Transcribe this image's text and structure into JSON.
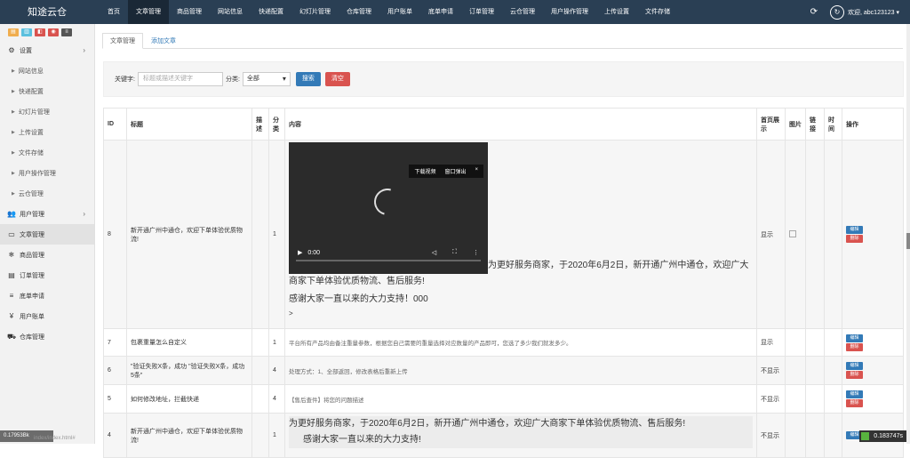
{
  "app": {
    "logo": "知途云仓"
  },
  "nav": {
    "items": [
      "首页",
      "文章管理",
      "商品管理",
      "网站信息",
      "快递配置",
      "幻灯片管理",
      "仓库管理",
      "用户账单",
      "底单申请",
      "订单管理",
      "云仓管理",
      "用户操作管理",
      "上传设置",
      "文件存储"
    ],
    "active_index": 1,
    "welcome": "欢迎, abc123123 ▾"
  },
  "sidebar": {
    "buttons": [
      "▤",
      "▥",
      "◧",
      "◉",
      "≡"
    ],
    "button_colors": [
      "#f0ad4e",
      "#5bc0de",
      "#d9534f",
      "#d9534f",
      "#555555"
    ],
    "items": [
      {
        "label": "设置",
        "icon": "gears-icon",
        "glyph": "⚙",
        "chev": "›",
        "sub": false
      },
      {
        "label": "网站信息",
        "sub": true
      },
      {
        "label": "快递配置",
        "sub": true
      },
      {
        "label": "幻灯片管理",
        "sub": true
      },
      {
        "label": "上传设置",
        "sub": true
      },
      {
        "label": "文件存储",
        "sub": true
      },
      {
        "label": "用户操作管理",
        "sub": true
      },
      {
        "label": "云仓管理",
        "sub": true
      },
      {
        "label": "用户管理",
        "icon": "users-icon",
        "glyph": "👥",
        "chev": "›",
        "sub": false
      },
      {
        "label": "文章管理",
        "icon": "list-alt-icon",
        "glyph": "▭",
        "sub": false,
        "active": true
      },
      {
        "label": "商品管理",
        "icon": "snowflake-icon",
        "glyph": "❄",
        "sub": false
      },
      {
        "label": "订单管理",
        "icon": "file-icon",
        "glyph": "▤",
        "sub": false
      },
      {
        "label": "底单申请",
        "icon": "bars-icon",
        "glyph": "≡",
        "sub": false
      },
      {
        "label": "用户账单",
        "icon": "yen-icon",
        "glyph": "¥",
        "sub": false
      },
      {
        "label": "仓库管理",
        "icon": "truck-icon",
        "glyph": "⛟",
        "sub": false
      }
    ]
  },
  "tabs": [
    "文章管理",
    "添加文章"
  ],
  "filter": {
    "keyword_label": "关键字:",
    "keyword_placeholder": "标题或描述关键字",
    "category_label": "分类:",
    "category_value": "全部",
    "search_label": "搜索",
    "clear_label": "清空"
  },
  "table": {
    "headers": [
      "ID",
      "标题",
      "描述",
      "分类",
      "内容",
      "首页展示",
      "图片",
      "链接",
      "时间",
      "操作"
    ],
    "edit_label": "编辑",
    "delete_label": "删除",
    "rows": [
      {
        "id": "8",
        "title": "新开通广州中通仓，欢迎下单体验优质物流!",
        "category": "1",
        "content_text": "为更好服务商家，于2020年6月2日，新开通广州中通仓，欢迎广大商家下单体验优质物流、售后服务!",
        "content_text2": "感谢大家一直以来的大力支持！000",
        "content_more": ">",
        "video_time": "0:00",
        "video_menu": [
          "下载视频",
          "窗口弹出",
          "×"
        ],
        "home_show": "显示"
      },
      {
        "id": "7",
        "title": "包裹重量怎么自定义",
        "category": "1",
        "content_text": "平台所有产品均由备注重量参数，根据您自己需要的重量选择对应数量的产品即可，您选了多少我们就发多少。",
        "home_show": "显示"
      },
      {
        "id": "6",
        "title": "\"验证失败X条，成功 \"验证失败X条，成功5条\"",
        "category": "4",
        "content_text": "处理方式：1、全部返回，修改表格后重新上传",
        "home_show": "不显示"
      },
      {
        "id": "5",
        "title": "如何修改地址，拦截快递",
        "category": "4",
        "content_text": "【售后查件】将您的问题描述",
        "home_show": "不显示"
      },
      {
        "id": "4",
        "title": "新开通广州中通仓，欢迎下单体验优质物流!",
        "category": "1",
        "content_text": "为更好服务商家，于2020年6月2日，新开通广州中通仓，欢迎广大商家下单体验优质物流、售后服务!",
        "content_text2": "感谢大家一直以来的大力支持!",
        "home_show": "不显示"
      }
    ]
  },
  "status": {
    "left": "0.17953Bk",
    "url": "index/index.html#",
    "right": "0.183747s"
  }
}
